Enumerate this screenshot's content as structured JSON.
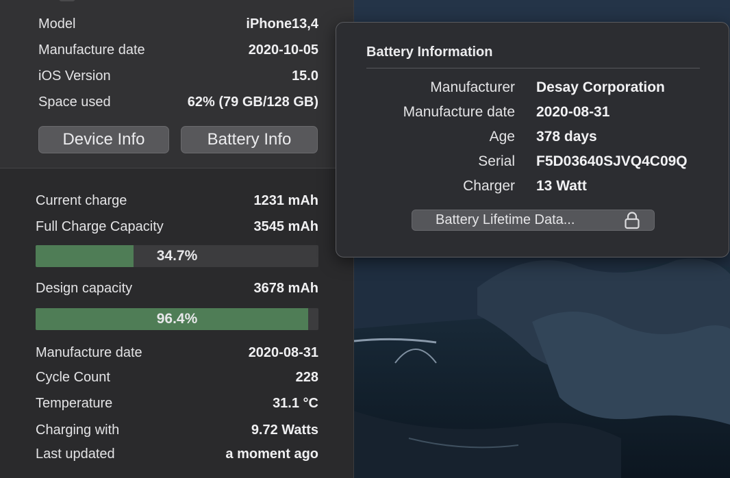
{
  "device": {
    "rows": [
      {
        "label": "Model",
        "value": "iPhone13,4"
      },
      {
        "label": "Manufacture date",
        "value": "2020-10-05"
      },
      {
        "label": "iOS Version",
        "value": "15.0"
      },
      {
        "label": "Space used",
        "value": "62% (79 GB/128 GB)"
      }
    ],
    "buttons": {
      "device_info": "Device Info",
      "battery_info": "Battery Info"
    }
  },
  "battery": {
    "current_charge": {
      "label": "Current charge",
      "value": "1231 mAh"
    },
    "full_charge": {
      "label": "Full Charge Capacity",
      "value": "3545 mAh"
    },
    "charge_bar": {
      "percent_label": "34.7%",
      "fraction": 0.347
    },
    "design_capacity": {
      "label": "Design capacity",
      "value": "3678 mAh"
    },
    "health_bar": {
      "percent_label": "96.4%",
      "fraction": 0.964
    },
    "details": [
      {
        "label": "Manufacture date",
        "value": "2020-08-31"
      },
      {
        "label": "Cycle Count",
        "value": "228"
      },
      {
        "label": "Temperature",
        "value": "31.1 °C"
      },
      {
        "label": "Charging with",
        "value": "9.72 Watts"
      },
      {
        "label": "Last updated",
        "value": "a moment ago"
      }
    ]
  },
  "popover": {
    "title": "Battery Information",
    "rows": [
      {
        "label": "Manufacturer",
        "value": "Desay Corporation"
      },
      {
        "label": "Manufacture date",
        "value": "2020-08-31"
      },
      {
        "label": "Age",
        "value": "378 days"
      },
      {
        "label": "Serial",
        "value": "F5D03640SJVQ4C09Q"
      },
      {
        "label": "Charger",
        "value": "13 Watt"
      }
    ],
    "lifetime_button": "Battery Lifetime Data...",
    "lock_icon": "lock-icon"
  },
  "colors": {
    "bar_fill": "#4f7d56",
    "panel_bg": "#2a2a2c",
    "popover_bg": "#2c2d31"
  }
}
